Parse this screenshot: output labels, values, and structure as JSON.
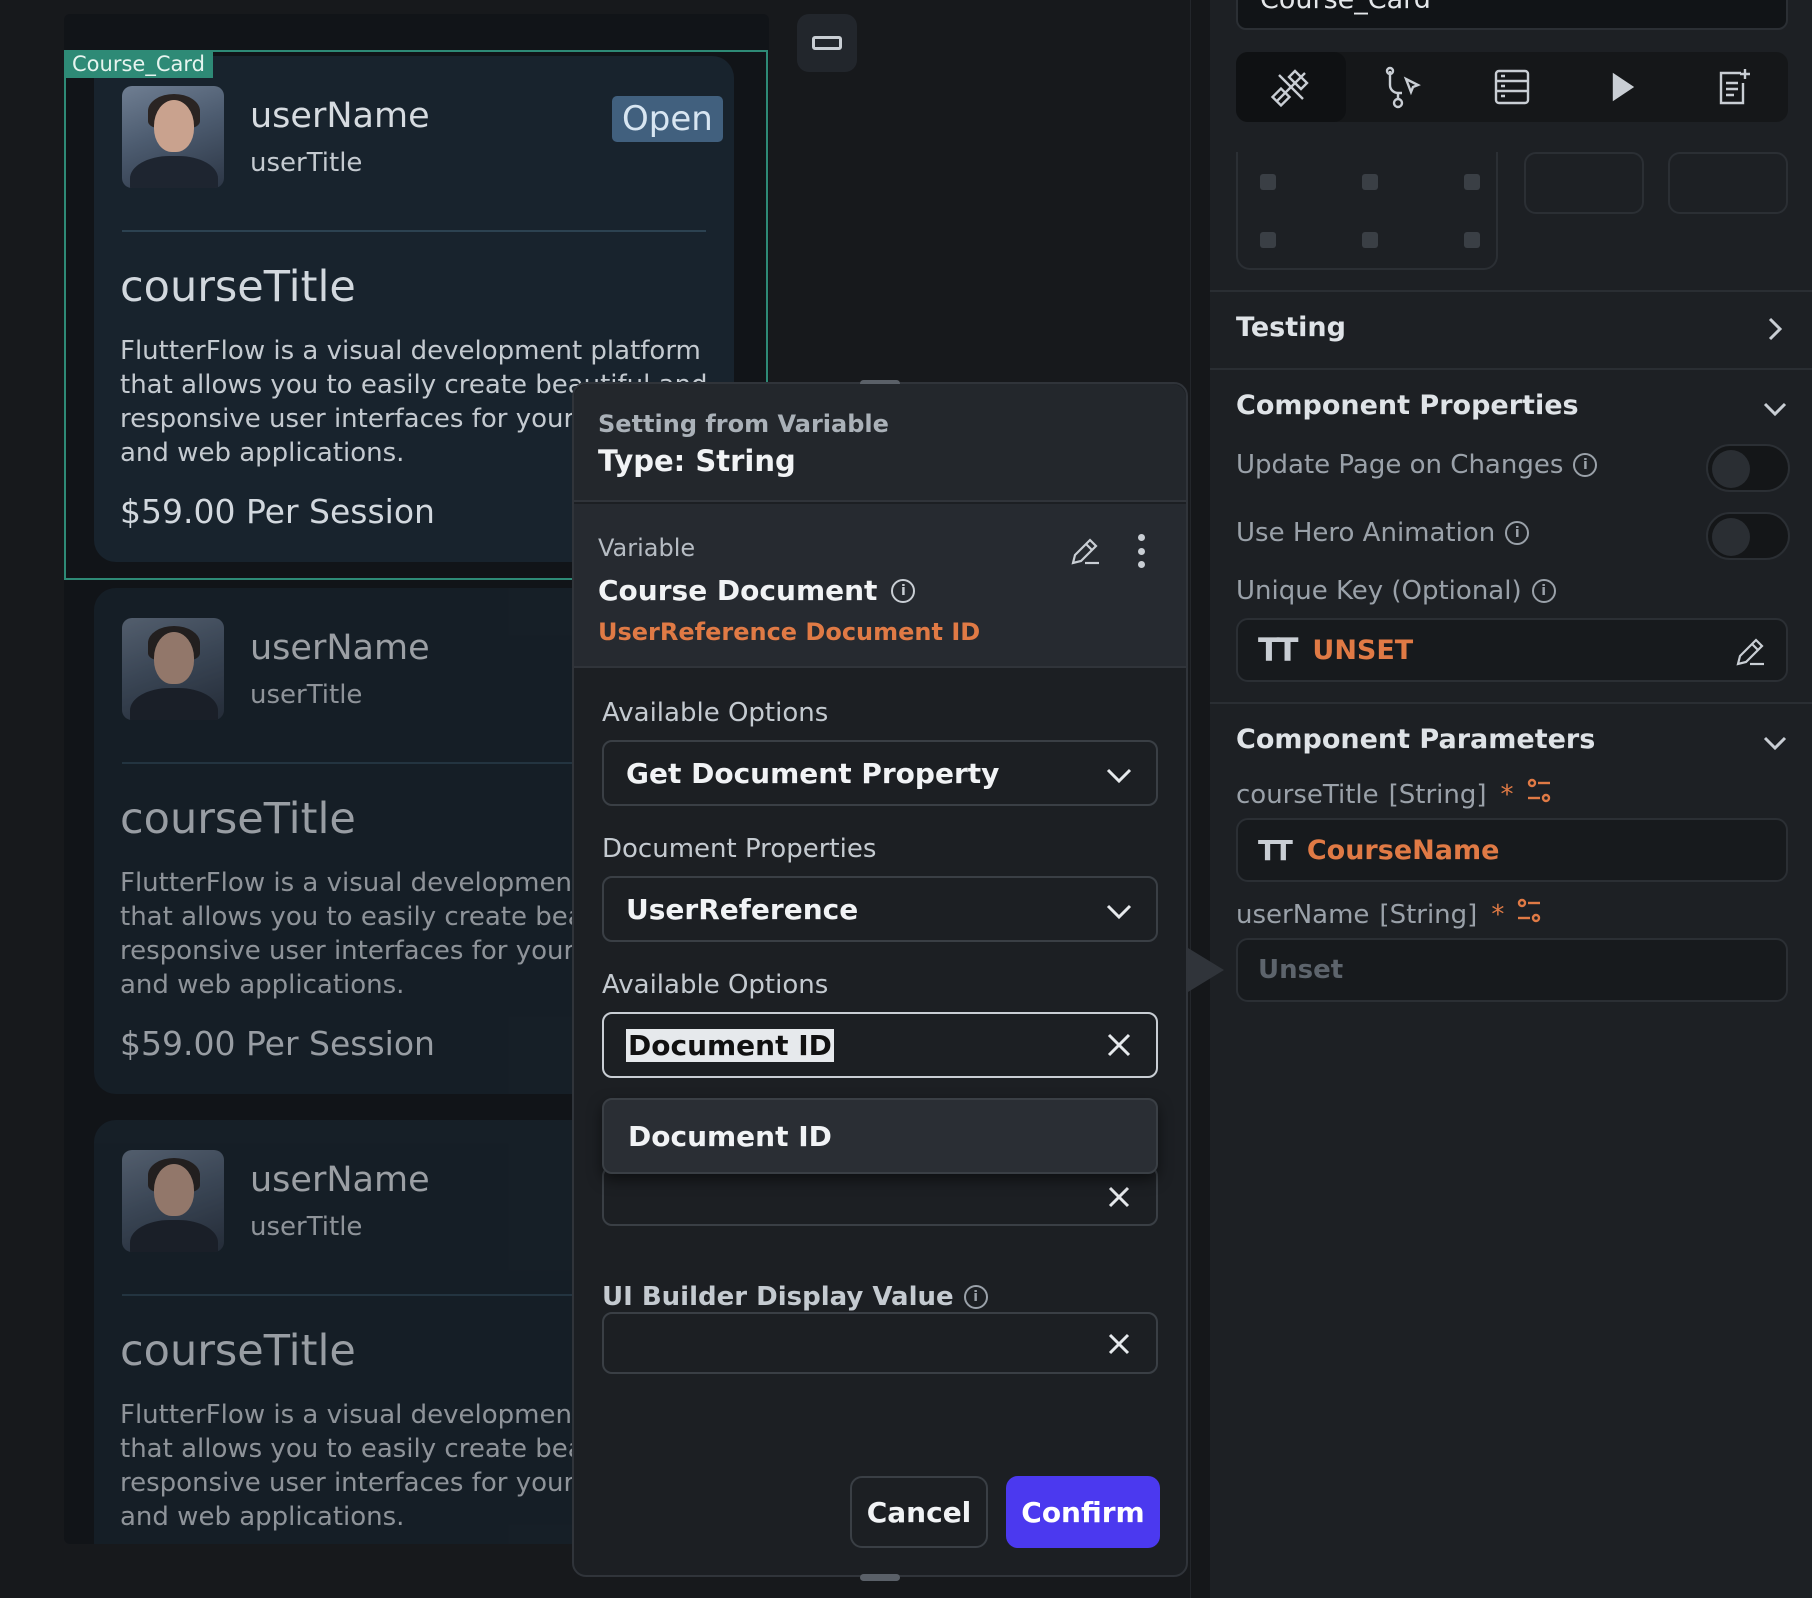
{
  "canvas": {
    "selected_component_tag": "Course_Card",
    "cards": [
      {
        "user_name": "userName",
        "user_title": "userTitle",
        "badge": "Open",
        "course_title": "courseTitle",
        "description": "FlutterFlow is a visual development platform that allows you to easily create beautiful and responsive user interfaces for your mobile and web applications.",
        "price": "$59.00 Per Session"
      },
      {
        "user_name": "userName",
        "user_title": "userTitle",
        "course_title": "courseTitle",
        "description": "FlutterFlow is a visual development platform that allows you to easily create beautiful and responsive user interfaces for your mobile and web applications.",
        "price": "$59.00 Per Session"
      },
      {
        "user_name": "userName",
        "user_title": "userTitle",
        "course_title": "courseTitle",
        "description": "FlutterFlow is a visual development platform that allows you to easily create beautiful and responsive user interfaces for your mobile and web applications."
      }
    ]
  },
  "panel": {
    "component_name": "Course_Card",
    "tab_icons": [
      "properties-icon",
      "actions-icon",
      "backend-query-icon",
      "animation-play-icon",
      "documentation-icon"
    ],
    "testing_label": "Testing",
    "component_properties": {
      "title": "Component Properties",
      "update_page_label": "Update Page on Changes",
      "hero_animation_label": "Use Hero Animation",
      "unique_key_label": "Unique Key (Optional)",
      "unique_key_value": "UNSET"
    },
    "component_parameters": {
      "title": "Component Parameters",
      "course_title_label": "courseTitle",
      "course_title_type": "[String]",
      "course_title_value": "CourseName",
      "user_name_label": "userName",
      "user_name_type": "[String]",
      "user_name_value": "Unset",
      "required_mark": "*"
    }
  },
  "modal": {
    "subtitle": "Setting from Variable",
    "type": "Type: String",
    "variable_label": "Variable",
    "variable_name": "Course Document",
    "variable_ref": "UserReference Document ID",
    "available_options_label": "Available Options",
    "available_options_value": "Get Document Property",
    "document_properties_label": "Document Properties",
    "document_properties_value": "UserReference",
    "available_options_label_2": "Available Options",
    "available_options_value_2": "Document ID",
    "dropdown_option": "Document ID",
    "ui_builder_label": "UI Builder Display Value",
    "cancel_label": "Cancel",
    "confirm_label": "Confirm"
  },
  "colors": {
    "accent": "#4b39ef",
    "orange": "#e07a45",
    "selection": "#2e8a76"
  }
}
